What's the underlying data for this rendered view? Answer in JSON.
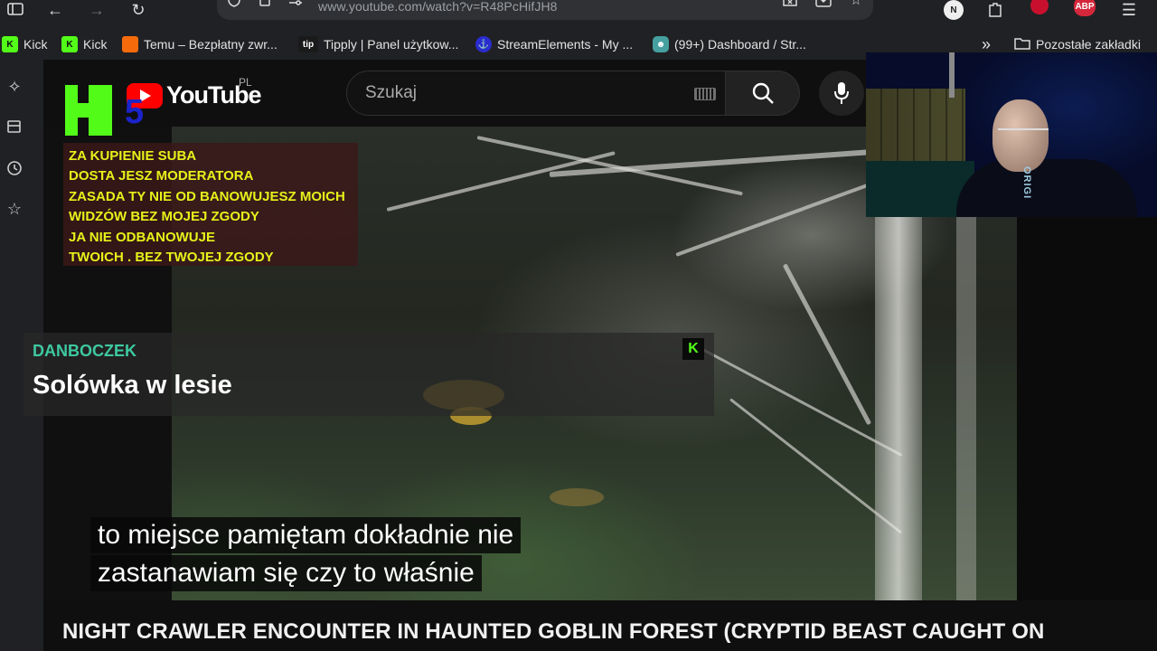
{
  "browser": {
    "url": "www.youtube.com/watch?v=R48PcHifJH8",
    "extensions": {
      "n_badge": "N",
      "abp_badge": "ABP"
    }
  },
  "bookmarks": {
    "items": [
      {
        "label": "Kick",
        "icon": "kick-icon"
      },
      {
        "label": "Kick",
        "icon": "kick-icon"
      },
      {
        "label": "Temu – Bezpłatny zwr...",
        "icon": "temu-icon"
      },
      {
        "label": "Tipply | Panel użytkow...",
        "icon": "tipply-icon"
      },
      {
        "label": "StreamElements - My ...",
        "icon": "streamelements-icon"
      },
      {
        "label": "(99+) Dashboard / Str...",
        "icon": "discord-icon"
      }
    ],
    "overflow_label": "»",
    "other_folder": "Pozostałe zakładki",
    "tip_icon_text": "tip"
  },
  "youtube": {
    "logo_text": "YouTube",
    "country_code": "PL",
    "search_placeholder": "Szukaj",
    "video_title": "NIGHT CRAWLER ENCOUNTER IN HAUNTED GOBLIN FOREST (CRYPTID BEAST CAUGHT ON"
  },
  "overlay": {
    "k5_digit": "5",
    "notice_lines": [
      "ZA KUPIENIE SUBA",
      "DOSTA JESZ MODERATORA",
      "ZASADA  TY NIE OD BANOWUJESZ MOICH",
      "WIDZÓW BEZ MOJEJ ZGODY",
      "JA NIE ODBANOWUJE",
      "TWOICH . BEZ TWOJEJ ZGODY"
    ],
    "alert": {
      "username": "DANBOCZEK",
      "message": "Solówka w lesie"
    },
    "kick_mini_letter": "K",
    "webcam_shirt_text": "ORIGI"
  },
  "captions": {
    "line1": "to miejsce pamiętam dokładnie nie",
    "line2": "zastanawiam się czy to właśnie"
  },
  "colors": {
    "kick_green": "#53fc18",
    "youtube_red": "#ff0000",
    "notice_text": "#e6f21a",
    "alert_user": "#3ec9a0"
  }
}
